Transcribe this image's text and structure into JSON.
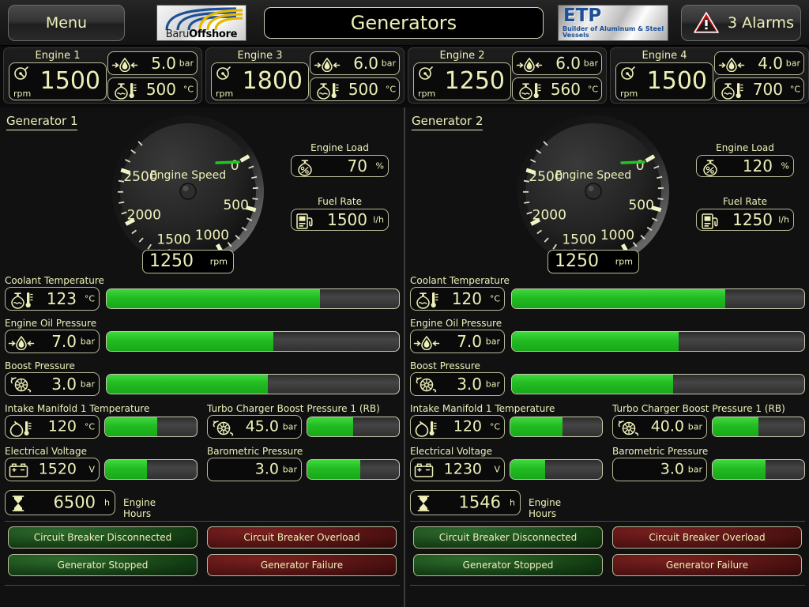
{
  "header": {
    "menu_label": "Menu",
    "title": "Generators",
    "alarm_label": "3 Alarms",
    "alarm_icon": "warning-triangle-icon",
    "logo_baru": {
      "text_light": "Baru",
      "text_bold": "Offshore"
    },
    "logo_etp": {
      "main": "ETP",
      "tagline": "Builder of Aluminum & Steel Vessels"
    }
  },
  "colors": {
    "cream": "#eef0b8",
    "green": "#25c025",
    "alarm_red": "#d81919",
    "panel_bg": "#111111",
    "field_bg": "#0a0a0a",
    "status_ok": "#123a12",
    "status_bad": "#4a1010"
  },
  "engines": [
    {
      "name": "Engine 1",
      "rpm": "1500",
      "rpm_unit": "rpm",
      "oil_pressure": "5.0",
      "oil_unit": "bar",
      "exhaust_temp": "500",
      "temp_unit": "°C"
    },
    {
      "name": "Engine 3",
      "rpm": "1800",
      "rpm_unit": "rpm",
      "oil_pressure": "6.0",
      "oil_unit": "bar",
      "exhaust_temp": "500",
      "temp_unit": "°C"
    },
    {
      "name": "Engine 2",
      "rpm": "1250",
      "rpm_unit": "rpm",
      "oil_pressure": "6.0",
      "oil_unit": "bar",
      "exhaust_temp": "560",
      "temp_unit": "°C"
    },
    {
      "name": "Engine 4",
      "rpm": "1500",
      "rpm_unit": "rpm",
      "oil_pressure": "4.0",
      "oil_unit": "bar",
      "exhaust_temp": "700",
      "temp_unit": "°C"
    }
  ],
  "gauge_common": {
    "dial_label": "Engine Speed",
    "tick_labels": [
      "500",
      "1000",
      "1500",
      "2000",
      "2500"
    ],
    "zero_label": "0",
    "min": 0,
    "max": 2800,
    "unit": "rpm"
  },
  "generators": [
    {
      "title": "Generator 1",
      "gauge_value": "1250",
      "engine_load": {
        "label": "Engine Load",
        "value": "70",
        "unit": "%",
        "icon": "load-percent-icon"
      },
      "fuel_rate": {
        "label": "Fuel Rate",
        "value": "1500",
        "unit": "l/h",
        "icon": "fuel-pump-icon"
      },
      "bars": [
        {
          "label": "Coolant Temperature",
          "value": "123",
          "unit": "°C",
          "icon": "coolant-thermometer-icon",
          "pct": 73
        },
        {
          "label": "Engine Oil Pressure",
          "value": "7.0",
          "unit": "bar",
          "icon": "oil-droplet-icon",
          "pct": 57
        },
        {
          "label": "Boost Pressure",
          "value": "3.0",
          "unit": "bar",
          "icon": "turbocharger-icon",
          "pct": 55
        }
      ],
      "metrics": [
        {
          "label": "Intake Manifold 1 Temperature",
          "value": "120",
          "unit": "°C",
          "icon": "manifold-temp-icon",
          "pct": 57
        },
        {
          "label": "Turbo Charger Boost Pressure 1 (RB)",
          "value": "45.0",
          "unit": "bar",
          "icon": "turbocharger-icon",
          "pct": 50
        },
        {
          "label": "Electrical Voltage",
          "value": "1520",
          "unit": "V",
          "icon": "battery-icon",
          "pct": 46
        },
        {
          "label": "Barometric Pressure",
          "value": "3.0",
          "unit": "bar",
          "icon": "none",
          "pct": 58
        }
      ],
      "engine_hours": {
        "label": "Engine Hours",
        "value": "6500",
        "unit": "h",
        "icon": "hourglass-icon"
      },
      "status": [
        {
          "text": "Circuit Breaker Disconnected",
          "state": "ok"
        },
        {
          "text": "Circuit Breaker Overload",
          "state": "bad"
        },
        {
          "text": "Generator Stopped",
          "state": "ok"
        },
        {
          "text": "Generator Failure",
          "state": "bad"
        }
      ]
    },
    {
      "title": "Generator 2",
      "gauge_value": "1250",
      "engine_load": {
        "label": "Engine Load",
        "value": "120",
        "unit": "%",
        "icon": "load-percent-icon"
      },
      "fuel_rate": {
        "label": "Fuel Rate",
        "value": "1250",
        "unit": "l/h",
        "icon": "fuel-pump-icon"
      },
      "bars": [
        {
          "label": "Coolant Temperature",
          "value": "120",
          "unit": "°C",
          "icon": "coolant-thermometer-icon",
          "pct": 73
        },
        {
          "label": "Engine Oil Pressure",
          "value": "7.0",
          "unit": "bar",
          "icon": "oil-droplet-icon",
          "pct": 57
        },
        {
          "label": "Boost Pressure",
          "value": "3.0",
          "unit": "bar",
          "icon": "turbocharger-icon",
          "pct": 55
        }
      ],
      "metrics": [
        {
          "label": "Intake Manifold 1 Temperature",
          "value": "120",
          "unit": "°C",
          "icon": "manifold-temp-icon",
          "pct": 57
        },
        {
          "label": "Turbo Charger Boost Pressure 1 (RB)",
          "value": "40.0",
          "unit": "bar",
          "icon": "turbocharger-icon",
          "pct": 50
        },
        {
          "label": "Electrical Voltage",
          "value": "1230",
          "unit": "V",
          "icon": "battery-icon",
          "pct": 38
        },
        {
          "label": "Barometric Pressure",
          "value": "3.0",
          "unit": "bar",
          "icon": "none",
          "pct": 58
        }
      ],
      "engine_hours": {
        "label": "Engine Hours",
        "value": "1546",
        "unit": "h",
        "icon": "hourglass-icon"
      },
      "status": [
        {
          "text": "Circuit Breaker Disconnected",
          "state": "ok"
        },
        {
          "text": "Circuit Breaker Overload",
          "state": "bad"
        },
        {
          "text": "Generator Stopped",
          "state": "ok"
        },
        {
          "text": "Generator Failure",
          "state": "bad"
        }
      ]
    }
  ]
}
